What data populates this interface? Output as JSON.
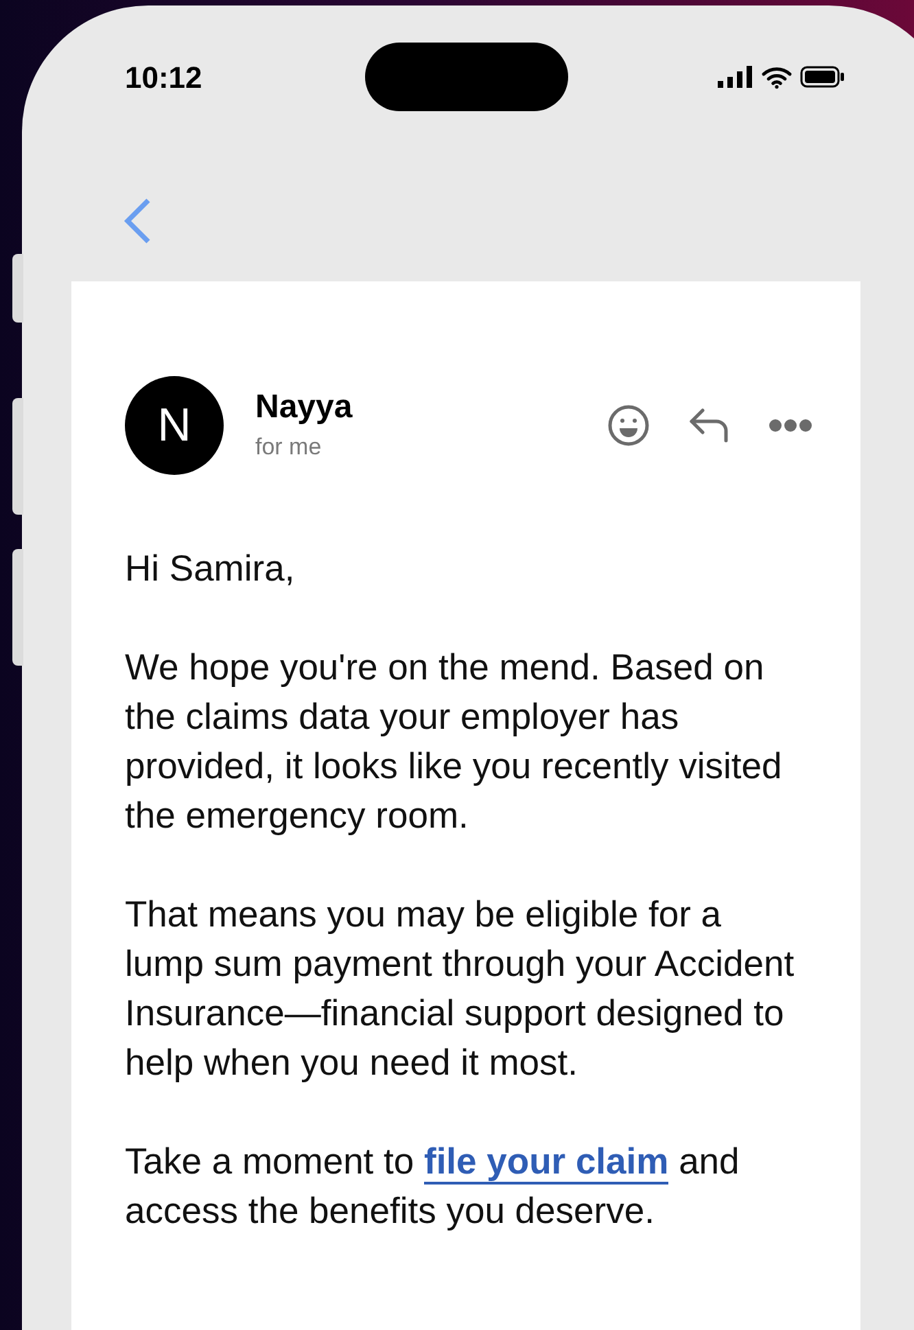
{
  "status_bar": {
    "time": "10:12"
  },
  "email": {
    "sender": {
      "initial": "N",
      "name": "Nayya",
      "recipient": "for me"
    },
    "greeting": "Hi Samira,",
    "paragraphs": [
      {
        "parts": [
          {
            "kind": "text",
            "text": "We hope you're on the mend. Based on the claims data your employer has provided, it looks like you recently visited the emergency room."
          }
        ]
      },
      {
        "parts": [
          {
            "kind": "text",
            "text": "That means you may be eligible for a lump sum payment through your Accident Insurance—financial support designed to help when you need it most."
          }
        ]
      },
      {
        "parts": [
          {
            "kind": "text",
            "text": "Take a moment to "
          },
          {
            "kind": "link",
            "text": "file your claim"
          },
          {
            "kind": "text",
            "text": " and access the benefits you deserve."
          }
        ]
      }
    ]
  }
}
